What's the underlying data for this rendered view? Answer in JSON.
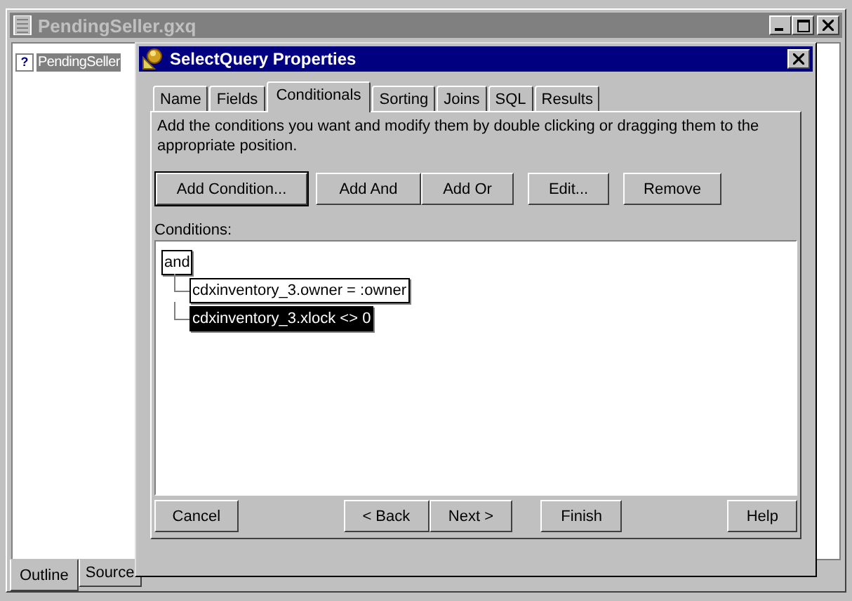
{
  "window": {
    "title": "PendingSeller.gxq"
  },
  "outline": {
    "items": [
      {
        "icon": "?",
        "label": "PendingSeller",
        "selected": true
      }
    ]
  },
  "dialog": {
    "title": "SelectQuery Properties",
    "tabs": [
      {
        "label": "Name",
        "selected": false
      },
      {
        "label": "Fields",
        "selected": false
      },
      {
        "label": "Conditionals",
        "selected": true
      },
      {
        "label": "Sorting",
        "selected": false
      },
      {
        "label": "Joins",
        "selected": false
      },
      {
        "label": "SQL",
        "selected": false
      },
      {
        "label": "Results",
        "selected": false
      }
    ],
    "instructions": "Add the conditions you want and modify them by double clicking or dragging them to the appropriate position.",
    "actions": [
      {
        "label": "Add Condition...",
        "default": true
      },
      {
        "label": "Add And",
        "default": false
      },
      {
        "label": "Add Or",
        "default": false
      },
      {
        "label": "Edit...",
        "default": false
      },
      {
        "label": "Remove",
        "default": false
      }
    ],
    "conditions_label": "Conditions:",
    "conditions": [
      {
        "label": "and",
        "selected": false,
        "children": [
          {
            "label": "cdxinventory_3.owner = :owner",
            "selected": false
          },
          {
            "label": "cdxinventory_3.xlock <> 0",
            "selected": true
          }
        ]
      }
    ],
    "wizard_buttons": [
      "Cancel",
      "< Back",
      "Next >",
      "Finish",
      "Help"
    ]
  },
  "bottom_tabs": [
    {
      "label": "Outline",
      "selected": true
    },
    {
      "label": "Source",
      "selected": false
    }
  ]
}
